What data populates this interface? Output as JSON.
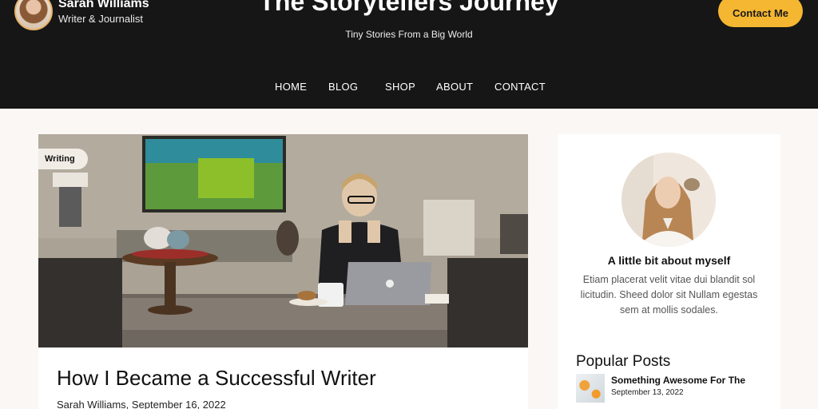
{
  "header": {
    "author_name": "Sarah Williams",
    "author_role": "Writer & Journalist",
    "site_title": "The Storytellers Journey",
    "tagline": "Tiny Stories From a Big World",
    "contact_label": "Contact Me",
    "accent_color": "#f5b731",
    "background_color": "#161616"
  },
  "nav": {
    "items": [
      {
        "label": "HOME"
      },
      {
        "label": "BLOG"
      },
      {
        "label": "SHOP"
      },
      {
        "label": "ABOUT"
      },
      {
        "label": "CONTACT"
      }
    ]
  },
  "post": {
    "category": "Writing",
    "title": "How I Became a Successful Writer",
    "meta": "Sarah Williams, September 16, 2022"
  },
  "sidebar": {
    "about_heading": "A little bit about myself",
    "about_text": "Etiam placerat velit vitae dui blandit sol licitudin. Sheed dolor sit Nullam egestas sem at mollis sodales.",
    "popular_heading": "Popular Posts",
    "popular_posts": [
      {
        "title": "Something Awesome For The",
        "date": "September 13, 2022"
      }
    ]
  }
}
